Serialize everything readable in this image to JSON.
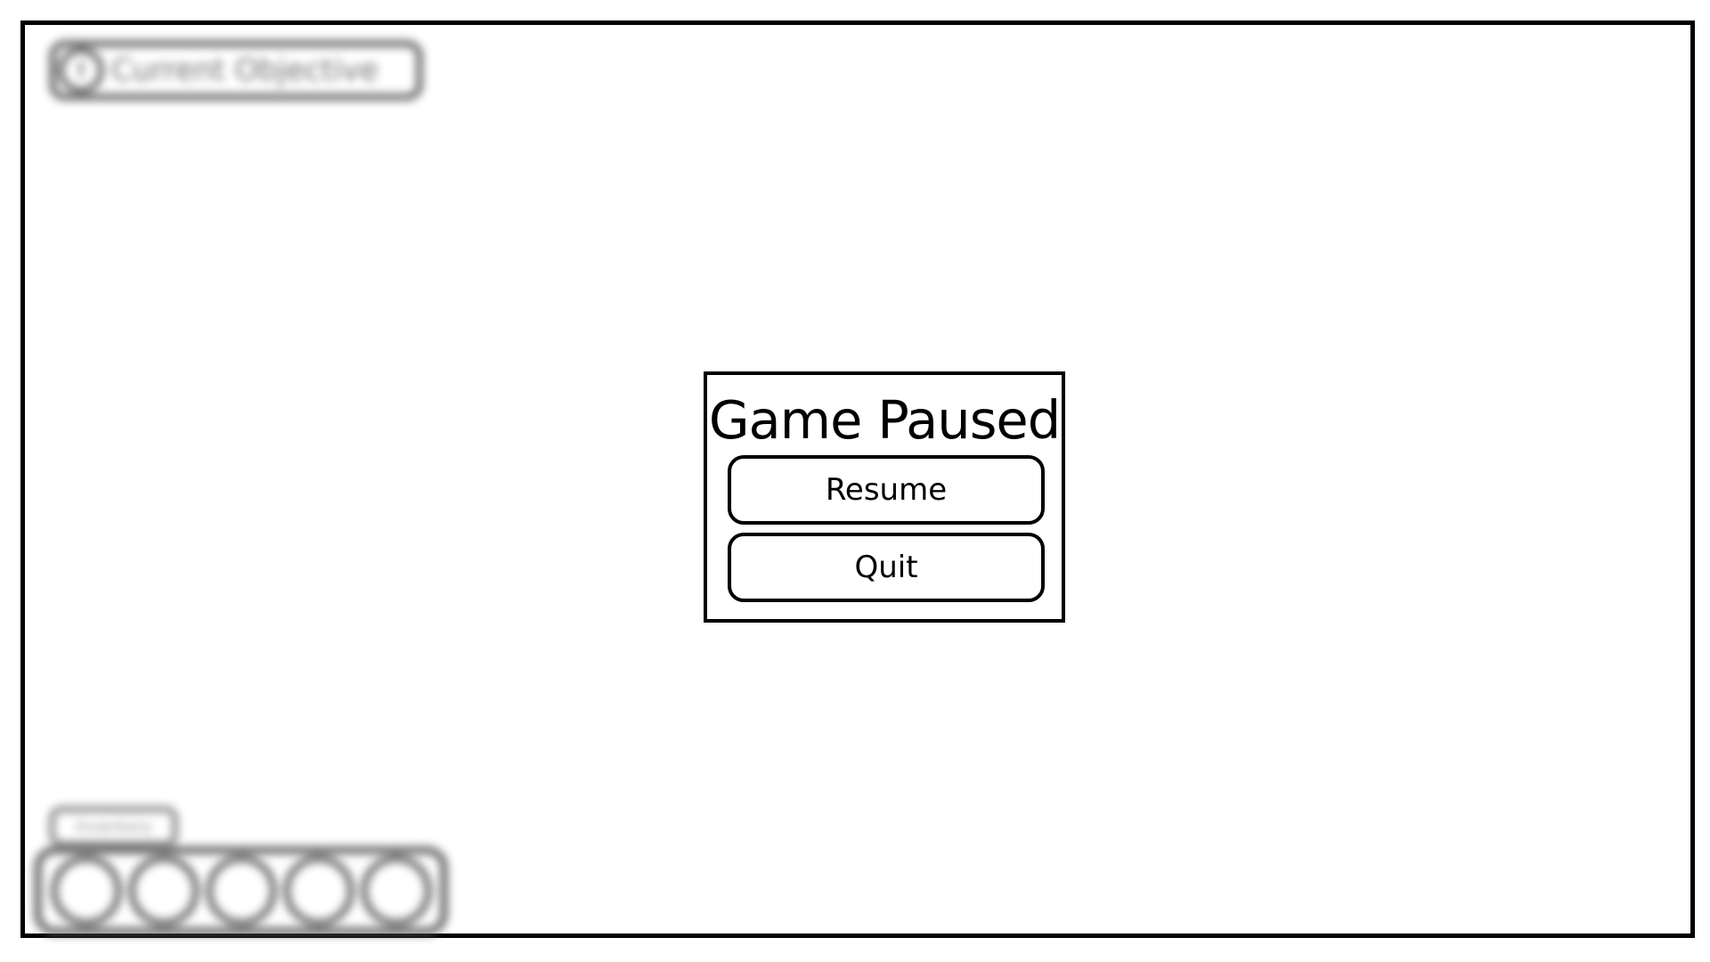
{
  "hud": {
    "objective_badge": "!",
    "objective_text": "Current Objective",
    "inventory_label": "Inventory",
    "hotbar_slot_count": 5
  },
  "pause_menu": {
    "title": "Game Paused",
    "buttons": {
      "resume": "Resume",
      "quit": "Quit"
    }
  },
  "colors": {
    "border": "#000000",
    "background": "#ffffff",
    "hud_gray": "#555555"
  }
}
